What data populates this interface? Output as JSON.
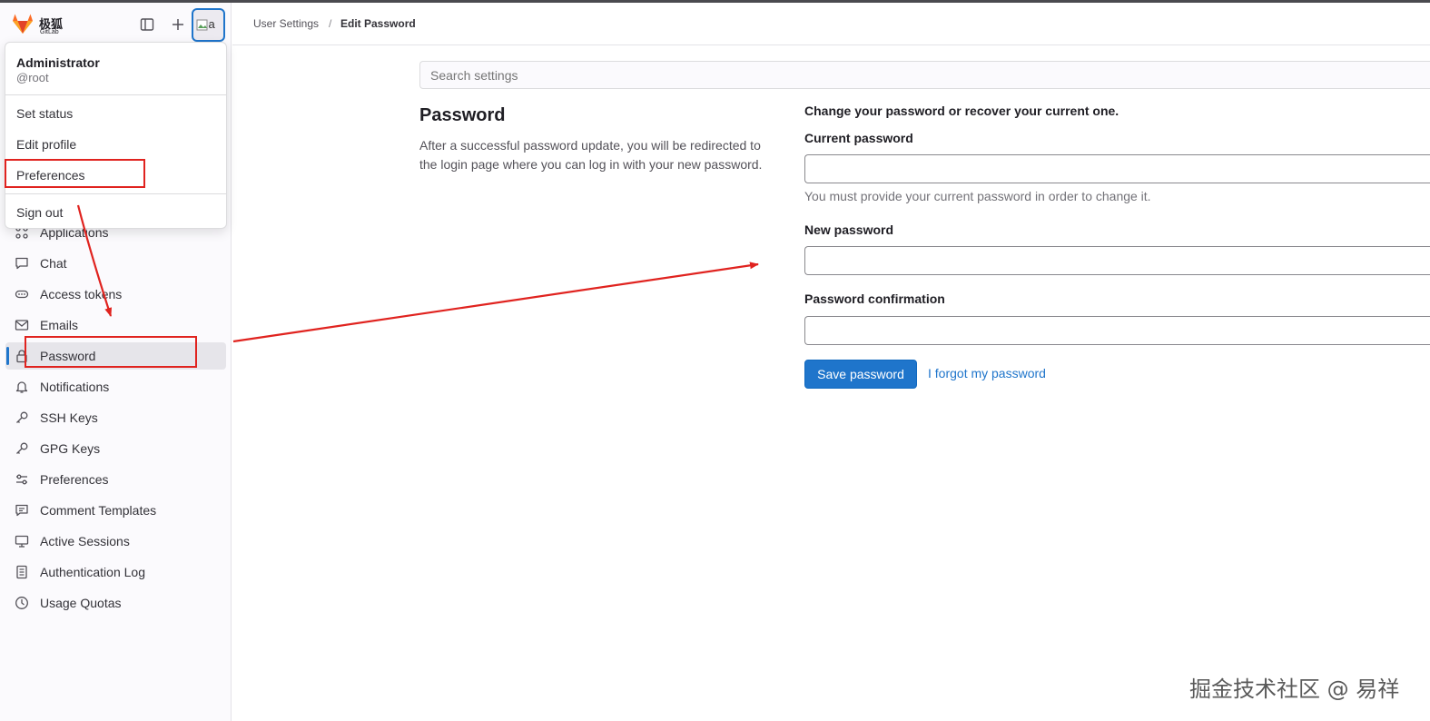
{
  "brand": {
    "name_cn": "极狐",
    "name_en": "GitLab"
  },
  "header": {
    "avatar_alt": "a"
  },
  "user_menu": {
    "name": "Administrator",
    "handle": "@root",
    "items": [
      "Set status",
      "Edit profile",
      "Preferences"
    ],
    "sign_out": "Sign out"
  },
  "sidebar": {
    "items": [
      {
        "label": "Applications",
        "icon": "applications-icon"
      },
      {
        "label": "Chat",
        "icon": "chat-icon"
      },
      {
        "label": "Access tokens",
        "icon": "token-icon"
      },
      {
        "label": "Emails",
        "icon": "mail-icon"
      },
      {
        "label": "Password",
        "icon": "lock-icon"
      },
      {
        "label": "Notifications",
        "icon": "bell-icon"
      },
      {
        "label": "SSH Keys",
        "icon": "key-icon"
      },
      {
        "label": "GPG Keys",
        "icon": "key-icon"
      },
      {
        "label": "Preferences",
        "icon": "preferences-icon"
      },
      {
        "label": "Comment Templates",
        "icon": "comment-icon"
      },
      {
        "label": "Active Sessions",
        "icon": "monitor-icon"
      },
      {
        "label": "Authentication Log",
        "icon": "log-icon"
      },
      {
        "label": "Usage Quotas",
        "icon": "quota-icon"
      }
    ],
    "active": "Password"
  },
  "breadcrumb": {
    "parent": "User Settings",
    "separator": "/",
    "current": "Edit Password"
  },
  "search": {
    "placeholder": "Search settings"
  },
  "section": {
    "title": "Password",
    "description": "After a successful password update, you will be redirected to the login page where you can log in with your new password."
  },
  "form": {
    "intro": "Change your password or recover your current one.",
    "current_label": "Current password",
    "current_help": "You must provide your current password in order to change it.",
    "new_label": "New password",
    "confirm_label": "Password confirmation",
    "save_label": "Save password",
    "forgot_label": "I forgot my password"
  },
  "watermark": "掘金技术社区 @ 易祥",
  "colors": {
    "accent": "#1f75cb",
    "annotation": "#e0231f"
  }
}
